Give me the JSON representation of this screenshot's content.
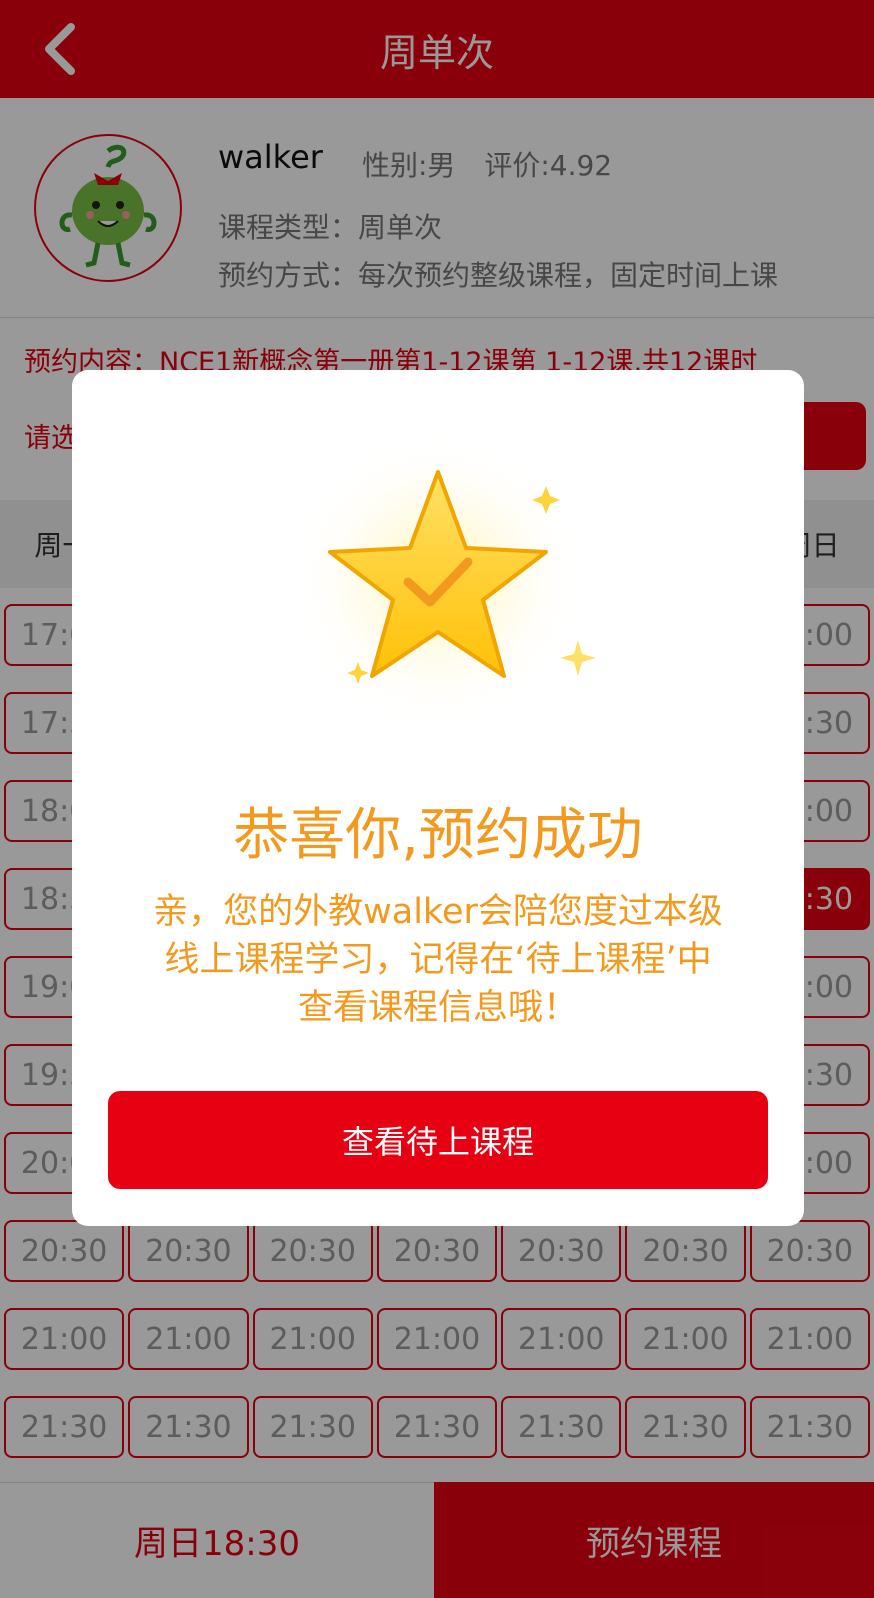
{
  "nav": {
    "title": "周单次"
  },
  "teacher": {
    "name": "walker",
    "gender": "性别:男",
    "rating": "评价:4.92",
    "course_type": "课程类型：周单次",
    "booking_mode": "预约方式：每次预约整级课程，固定时间上课"
  },
  "content": {
    "text": "预约内容：NCE1新概念第一册第1-12课第 1-12课,共12课时",
    "select_prefix": "请选"
  },
  "weekdays": [
    "周一",
    "",
    "",
    "",
    "",
    "",
    "周日"
  ],
  "time_slots": [
    "17:00",
    "17:30",
    "18:00",
    "18:30",
    "19:00",
    "19:30",
    "20:00",
    "20:30",
    "21:00",
    "21:30"
  ],
  "selected_slot": {
    "day_index": 6,
    "time": "18:30"
  },
  "bottom": {
    "selected_label": "周日18:30",
    "book_label": "预约课程"
  },
  "modal": {
    "title": "恭喜你,预约成功",
    "message": "亲，您的外教walker会陪您度过本级线上课程学习，记得在‘待上课程’中查看课程信息哦！",
    "button_label": "查看待上课程"
  },
  "colors": {
    "primary": "#e60012",
    "accent_orange": "#f39a1e",
    "star_yellow": "#ffd43b"
  }
}
